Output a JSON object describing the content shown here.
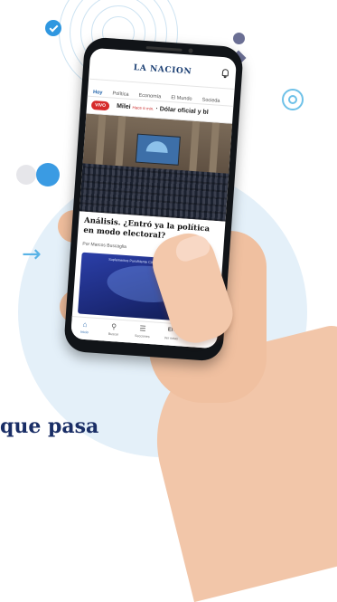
{
  "hero_text": "que pasa",
  "app": {
    "logo": "LA NACION",
    "tabs": [
      {
        "label": "Hoy",
        "active": true
      },
      {
        "label": "Política",
        "active": false
      },
      {
        "label": "Economía",
        "active": false
      },
      {
        "label": "El Mundo",
        "active": false
      },
      {
        "label": "Socieda",
        "active": false
      }
    ],
    "ticker": {
      "live_label": "VIVO",
      "item1": "Milei",
      "item1_time": "Hace 6 min.",
      "item2": "Dólar oficial y bl"
    },
    "article": {
      "headline": "Análisis. ¿Entró ya la política en modo electoral?",
      "byline": "Por Marcos Buscaglia"
    },
    "video_card": {
      "caption": "Suplementos   Puro/Mente Clásico"
    },
    "bottom_nav": [
      {
        "label": "Inicio",
        "icon": "home-icon",
        "glyph": "⌂",
        "active": true
      },
      {
        "label": "Buscar",
        "icon": "search-icon",
        "glyph": "⚲",
        "active": false
      },
      {
        "label": "Secciones",
        "icon": "menu-icon",
        "glyph": "☰",
        "active": false
      },
      {
        "label": "Ver notas",
        "icon": "notes-icon",
        "glyph": "EN",
        "active": false
      },
      {
        "label": "Pi",
        "icon": "profile-icon",
        "glyph": "◉",
        "active": false
      }
    ]
  },
  "colors": {
    "brand_navy": "#1b3f73",
    "accent_blue": "#1b5fa8",
    "live_red": "#d62b2b",
    "background_circle": "#e4f0f9"
  }
}
